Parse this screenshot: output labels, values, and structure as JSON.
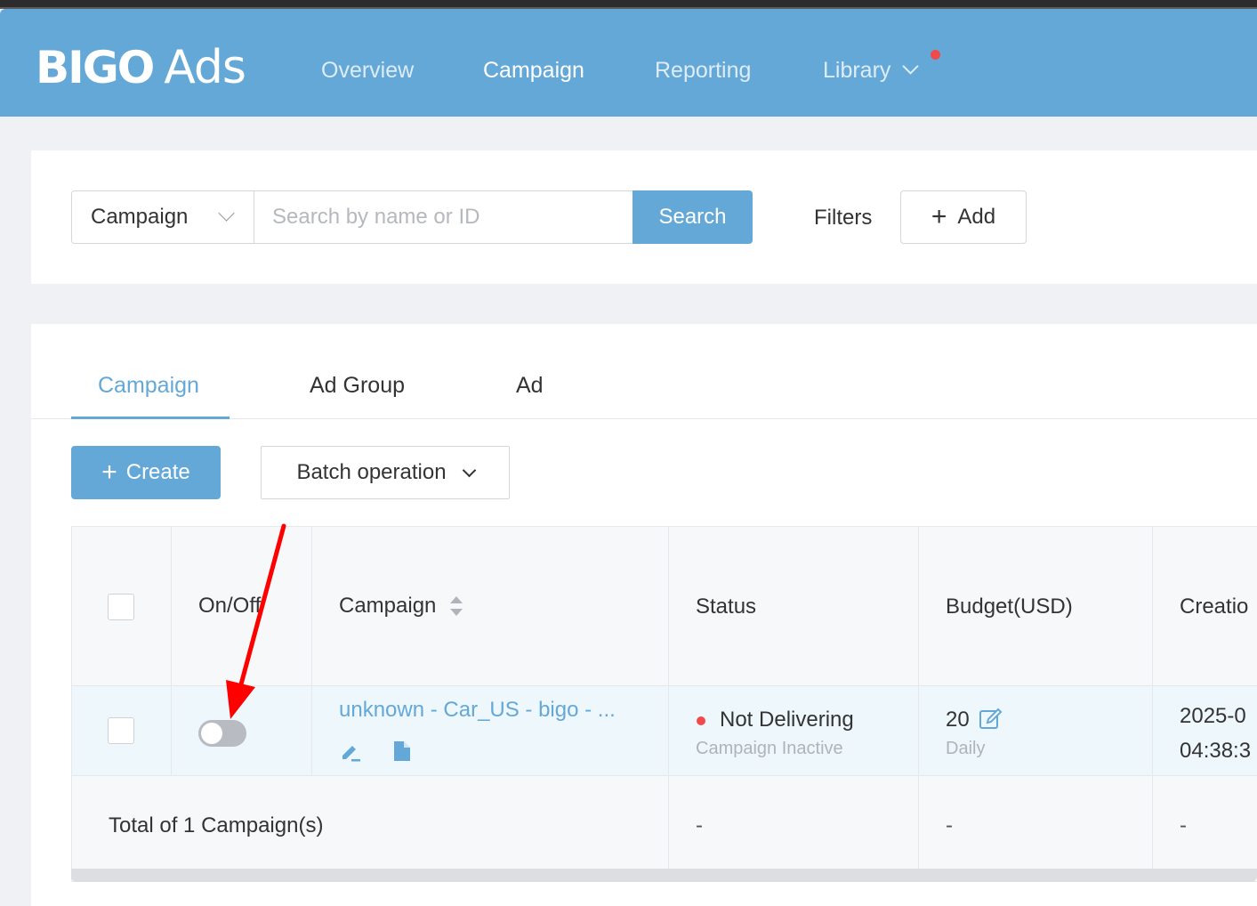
{
  "brand": {
    "logo_main": "BIGO",
    "logo_suffix": "Ads"
  },
  "nav": {
    "items": [
      {
        "label": "Overview",
        "active": false
      },
      {
        "label": "Campaign",
        "active": true
      },
      {
        "label": "Reporting",
        "active": false
      },
      {
        "label": "Library",
        "active": false,
        "has_dropdown": true,
        "has_notification_dot": true
      }
    ]
  },
  "search": {
    "type_select": "Campaign",
    "placeholder": "Search by name or ID",
    "button_label": "Search",
    "filters_label": "Filters",
    "add_label": "Add"
  },
  "tabs": [
    {
      "label": "Campaign",
      "active": true
    },
    {
      "label": "Ad Group",
      "active": false
    },
    {
      "label": "Ad",
      "active": false
    }
  ],
  "toolbar": {
    "create_label": "Create",
    "batch_label": "Batch operation"
  },
  "table": {
    "headers": {
      "onoff": "On/Off",
      "campaign": "Campaign",
      "status": "Status",
      "budget": "Budget(USD)",
      "creation": "Creatio"
    },
    "rows": [
      {
        "enabled": false,
        "campaign_name": "unknown - Car_US - bigo - ...",
        "status": "Not Delivering",
        "status_detail": "Campaign Inactive",
        "budget": "20",
        "budget_type": "Daily",
        "creation_date": "2025-0",
        "creation_time": "04:38:3"
      }
    ],
    "total": {
      "label": "Total of 1 Campaign(s)",
      "status": "-",
      "budget": "-",
      "creation": "-"
    }
  },
  "colors": {
    "brand_blue": "#64a8d8",
    "status_red": "#f04a4a",
    "annotation_arrow": "#ff0000"
  }
}
